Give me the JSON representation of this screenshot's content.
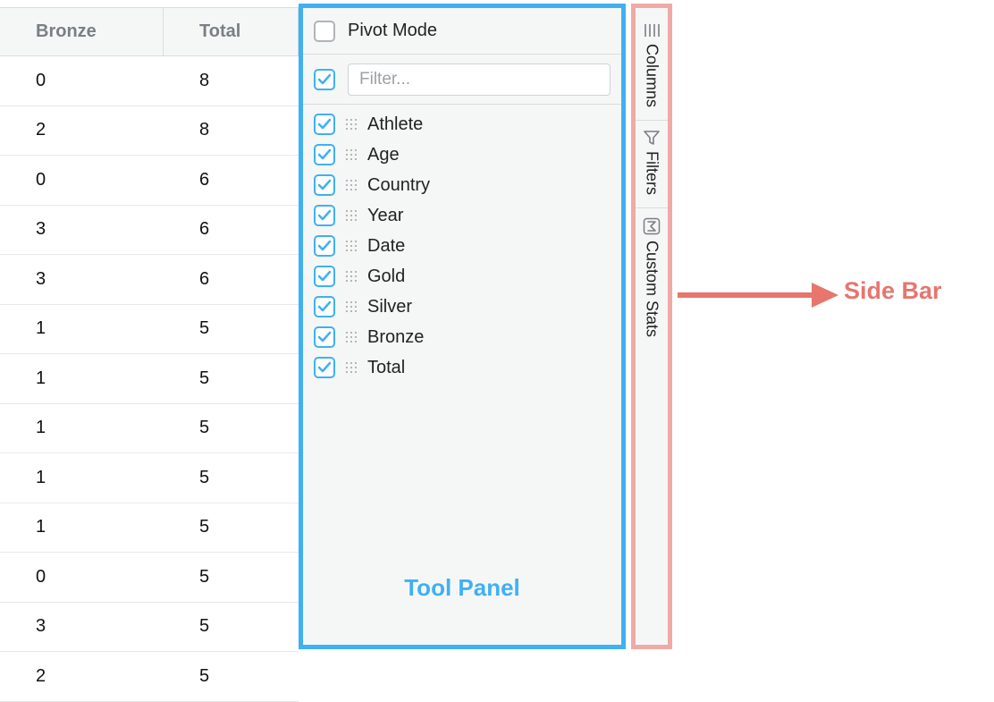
{
  "table": {
    "headers": {
      "bronze": "Bronze",
      "total": "Total"
    },
    "rows": [
      {
        "bronze": "0",
        "total": "8"
      },
      {
        "bronze": "2",
        "total": "8"
      },
      {
        "bronze": "0",
        "total": "6"
      },
      {
        "bronze": "3",
        "total": "6"
      },
      {
        "bronze": "3",
        "total": "6"
      },
      {
        "bronze": "1",
        "total": "5"
      },
      {
        "bronze": "1",
        "total": "5"
      },
      {
        "bronze": "1",
        "total": "5"
      },
      {
        "bronze": "1",
        "total": "5"
      },
      {
        "bronze": "1",
        "total": "5"
      },
      {
        "bronze": "0",
        "total": "5"
      },
      {
        "bronze": "3",
        "total": "5"
      },
      {
        "bronze": "2",
        "total": "5"
      }
    ]
  },
  "toolPanel": {
    "pivot": {
      "label": "Pivot Mode",
      "checked": false
    },
    "filter": {
      "placeholder": "Filter...",
      "value": "",
      "checked": true
    },
    "columns": [
      {
        "label": "Athlete",
        "checked": true
      },
      {
        "label": "Age",
        "checked": true
      },
      {
        "label": "Country",
        "checked": true
      },
      {
        "label": "Year",
        "checked": true
      },
      {
        "label": "Date",
        "checked": true
      },
      {
        "label": "Gold",
        "checked": true
      },
      {
        "label": "Silver",
        "checked": true
      },
      {
        "label": "Bronze",
        "checked": true
      },
      {
        "label": "Total",
        "checked": true
      }
    ],
    "caption": "Tool Panel"
  },
  "sideBar": {
    "tabs": [
      {
        "label": "Columns",
        "icon": "columns-icon"
      },
      {
        "label": "Filters",
        "icon": "funnel-icon"
      },
      {
        "label": "Custom Stats",
        "icon": "sigma-icon"
      }
    ],
    "caption": "Side Bar"
  },
  "colors": {
    "toolPanelBorder": "#40b0f2",
    "sideBarBorder": "#f0aaa5",
    "annotation": "#e6766e"
  }
}
